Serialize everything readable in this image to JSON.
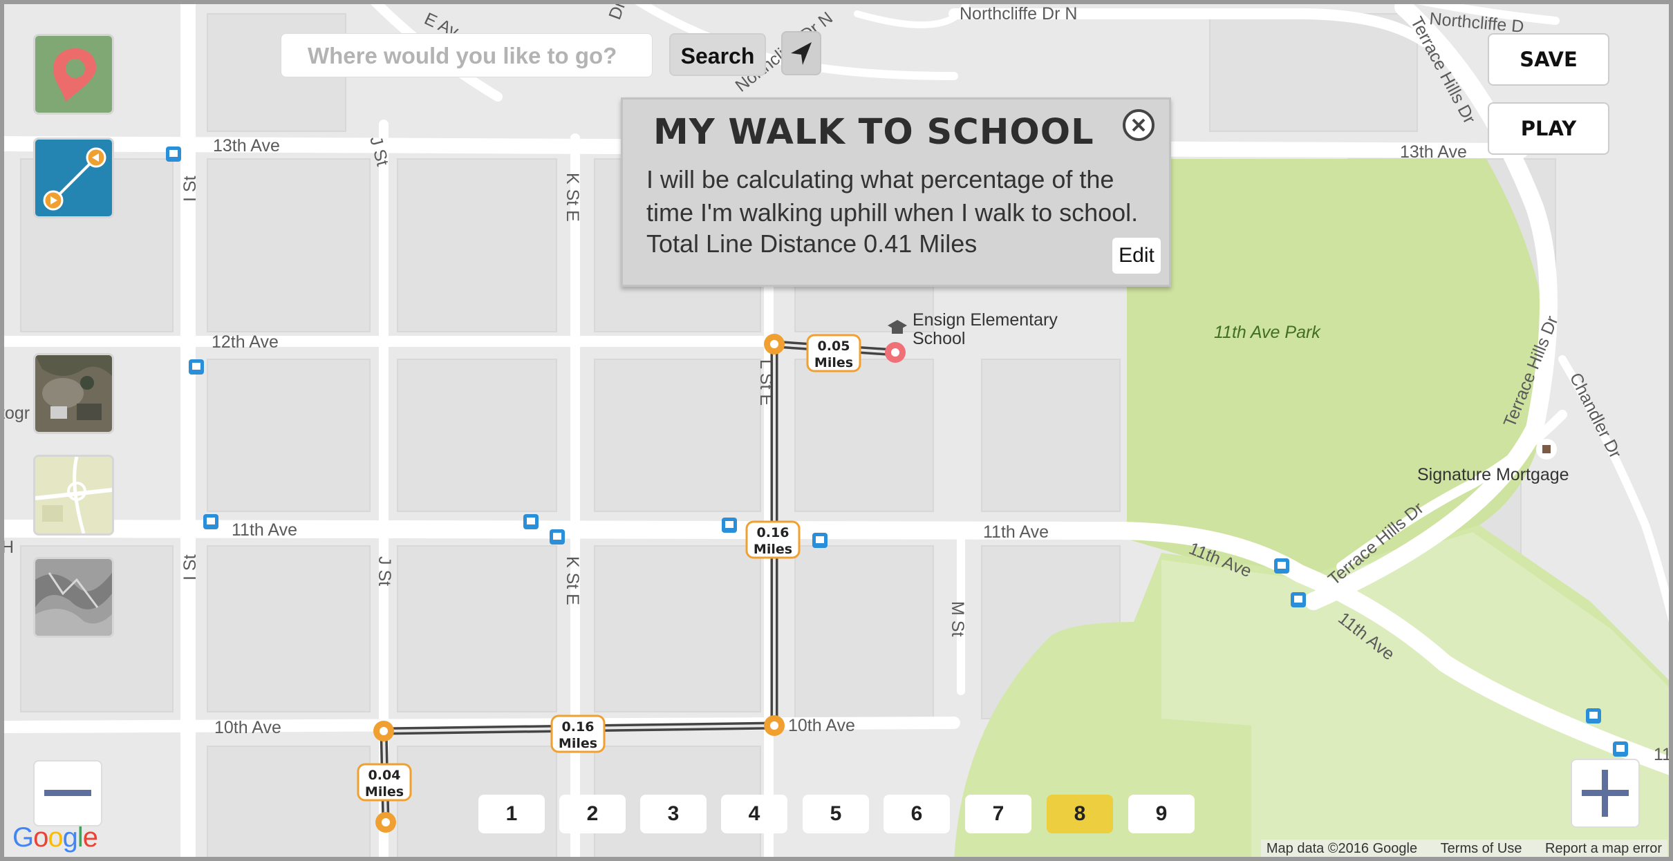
{
  "search": {
    "placeholder": "Where would you like to go?",
    "button_label": "Search"
  },
  "info_panel": {
    "title": "MY WALK TO SCHOOL",
    "description": "I will be calculating what percentage of the time I'm walking uphill when I walk to school.",
    "total_distance": "Total Line Distance 0.41 Miles",
    "edit_label": "Edit"
  },
  "actions": {
    "save_label": "SAVE",
    "play_label": "PLAY"
  },
  "pages": {
    "items": [
      "1",
      "2",
      "3",
      "4",
      "5",
      "6",
      "7",
      "8",
      "9"
    ],
    "active": "8"
  },
  "map": {
    "streets": {
      "ave_13": "13th Ave",
      "ave_13_east": "13th Ave",
      "ave_12": "12th Ave",
      "ave_11_west": "11th Ave",
      "ave_11_mid": "11th Ave",
      "ave_11_diag1": "11th Ave",
      "ave_11_diag2": "11th Ave",
      "ave_10_west": "10th Ave",
      "ave_10_east": "10th Ave",
      "i_st_north": "I St",
      "i_st_south": "I St",
      "j_st_north": "J St",
      "j_st_south": "J St",
      "k_st_north": "K St E",
      "k_st_south": "K St E",
      "l_st": "L St E",
      "m_st": "M St",
      "northcliffe_1": "Northcliffe Dr N",
      "northcliffe_2": "Northcliffe D",
      "northcliffe_3": "Northcliffe Dr N",
      "terrace_1": "Terrace Hills Dr",
      "terrace_2": "Terrace Hills Dr",
      "terrace_3": "Terrace Hills Dr",
      "chandler": "Chandler Dr",
      "e_ave": "E Av",
      "nord_dr": "Dr",
      "edge_11": "11",
      "edge_togr": "togr",
      "edge_h": "H"
    },
    "poi": {
      "school_line1": "Ensign Elementary",
      "school_line2": "School",
      "park": "11th Ave Park",
      "mortgage": "Signature Mortgage"
    },
    "route_segments": [
      {
        "value": "0.05",
        "unit": "Miles"
      },
      {
        "value": "0.16",
        "unit": "Miles"
      },
      {
        "value": "0.16",
        "unit": "Miles"
      },
      {
        "value": "0.04",
        "unit": "Miles"
      }
    ],
    "colors": {
      "route_marker": "#f0a030",
      "destination_marker": "#f07078",
      "park": "#cfe3a0",
      "road": "#ffffff",
      "block": "#e4e4e4"
    }
  },
  "attribution": {
    "data": "Map data ©2016 Google",
    "terms": "Terms of Use",
    "report": "Report a map error"
  },
  "icons": [
    "pin-tool-icon",
    "line-tool-icon",
    "satellite-layer-icon",
    "map-layer-icon",
    "terrain-layer-icon",
    "navigate-arrow-icon",
    "close-icon",
    "bus-stop-icon",
    "school-icon",
    "zoom-out-icon",
    "zoom-in-icon"
  ]
}
